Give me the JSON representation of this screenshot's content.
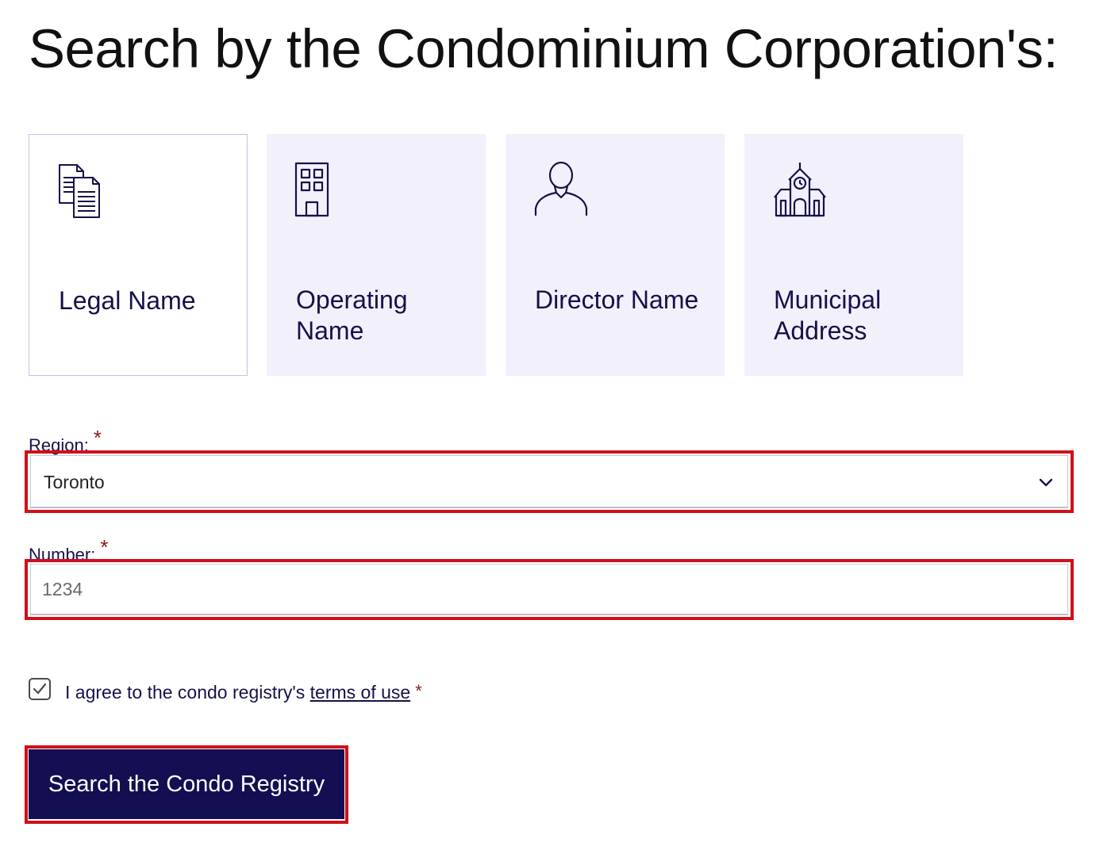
{
  "page": {
    "title": "Search by the Condominium Corporation's:"
  },
  "search_options": [
    {
      "label": "Legal Name",
      "icon": "documents-icon",
      "selected": true
    },
    {
      "label": "Operating Name",
      "icon": "building-icon",
      "selected": false
    },
    {
      "label": "Director Name",
      "icon": "person-icon",
      "selected": false
    },
    {
      "label": "Municipal Address",
      "icon": "city-hall-icon",
      "selected": false
    }
  ],
  "form": {
    "region": {
      "label": "Region:",
      "required_mark": "*",
      "value": "Toronto"
    },
    "number": {
      "label": "Number:",
      "required_mark": "*",
      "value": "",
      "placeholder": "1234"
    },
    "agree": {
      "checked": true,
      "text": "I agree to the condo registry's",
      "link_text": "terms of use",
      "required_mark": "*"
    },
    "submit_label": "Search the Condo Registry"
  },
  "colors": {
    "brand_navy": "#140f52",
    "card_background": "#f2f0fb",
    "highlight_red": "#d0101b",
    "required_red": "#8b1a1a"
  }
}
